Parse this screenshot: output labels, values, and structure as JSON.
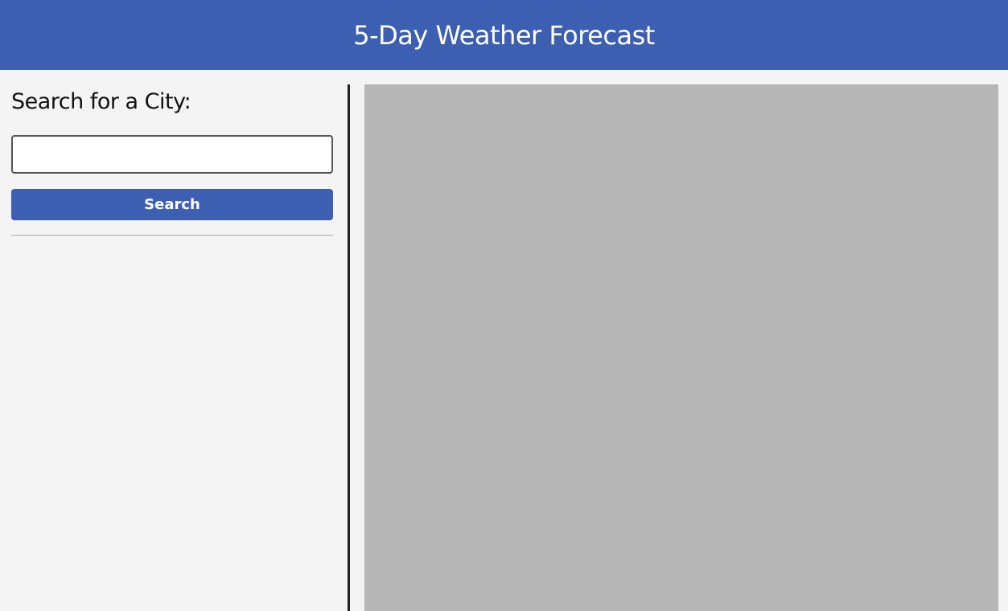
{
  "header": {
    "title": "5-Day Weather Forecast"
  },
  "sidebar": {
    "heading": "Search for a City:",
    "city_input": {
      "value": "",
      "placeholder": ""
    },
    "search_label": "Search"
  },
  "colors": {
    "brand": "#3d5fb2",
    "page_background": "#f4f4f4",
    "panel_background": "#b7b7b7",
    "separator": "#222222"
  }
}
